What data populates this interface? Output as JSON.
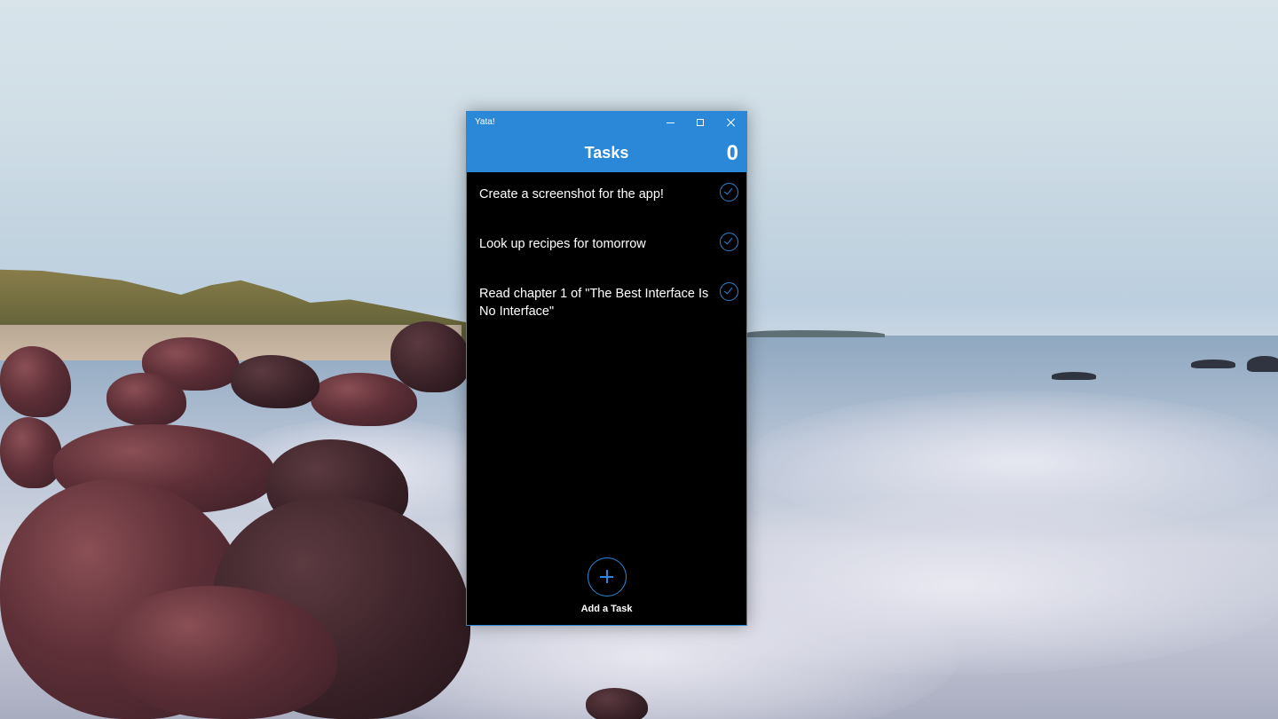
{
  "window": {
    "title": "Yata!"
  },
  "header": {
    "title": "Tasks",
    "count": "0"
  },
  "tasks": [
    {
      "text": "Create a screenshot for the app!"
    },
    {
      "text": "Look up recipes for tomorrow"
    },
    {
      "text": "Read chapter 1 of \"The Best Interface Is No Interface\""
    }
  ],
  "add_task": {
    "label": "Add a Task"
  },
  "colors": {
    "accent": "#2b88d8",
    "background": "#000000",
    "text": "#ffffff"
  },
  "icons": {
    "complete": "checkmark-circle-icon",
    "add": "plus-circle-icon",
    "minimize": "minimize-icon",
    "maximize": "maximize-icon",
    "close": "close-icon"
  }
}
